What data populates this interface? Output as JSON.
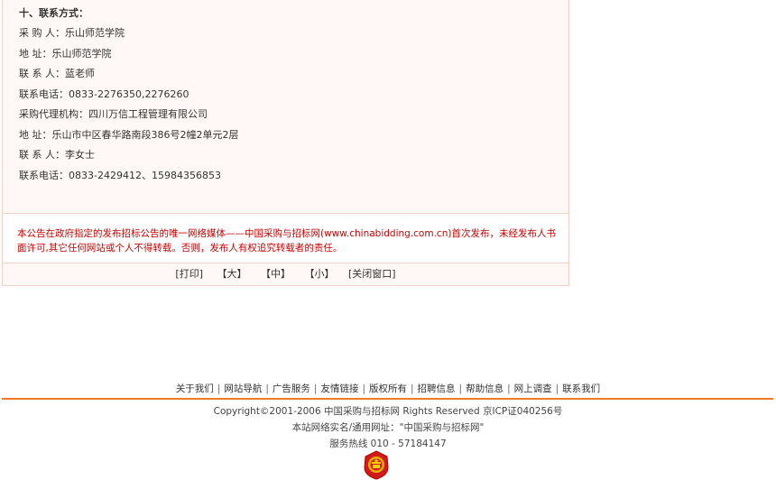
{
  "contact": {
    "heading": "十、联系方式：",
    "lines": [
      "采 购 人：乐山师范学院",
      "地 址：乐山师范学院",
      "联 系 人：蓝老师",
      "联系电话：0833-2276350,2276260",
      "采购代理机构：四川万信工程管理有限公司",
      "地 址：乐山市中区春华路南段386号2幢2单元2层",
      "联 系 人：李女士",
      "联系电话：0833-2429412、15984356853"
    ]
  },
  "notice": {
    "text": "本公告在政府指定的发布招标公告的唯一网络媒体——中国采购与招标网(www.chinabidding.com.cn)首次发布，未经发布人书面许可,其它任何网站或个人不得转载。否则，发布人有权追究转载者的责任。"
  },
  "actions": {
    "print": "[打印]",
    "large": "【大】",
    "medium": "【中】",
    "small": "【小】",
    "close": "[关闭窗口]"
  },
  "footer": {
    "links": [
      "关于我们",
      "网站导航",
      "广告服务",
      "友情链接",
      "版权所有",
      "招聘信息",
      "帮助信息",
      "网上调查",
      "联系我们"
    ],
    "separator": "|",
    "copyright": "Copyright©2001-2006 中国采购与招标网 Rights Reserved 京ICP证040256号",
    "site_name": "本站网络实名/通用网址：\"中国采购与招标网\"",
    "hotline": "服务热线 010 - 57184147"
  },
  "colors": {
    "accent_line": "#f07a2c",
    "notice_text": "#cc0000",
    "panel_border": "#f3cfc6"
  },
  "emblem_icon": "national-emblem-icon"
}
